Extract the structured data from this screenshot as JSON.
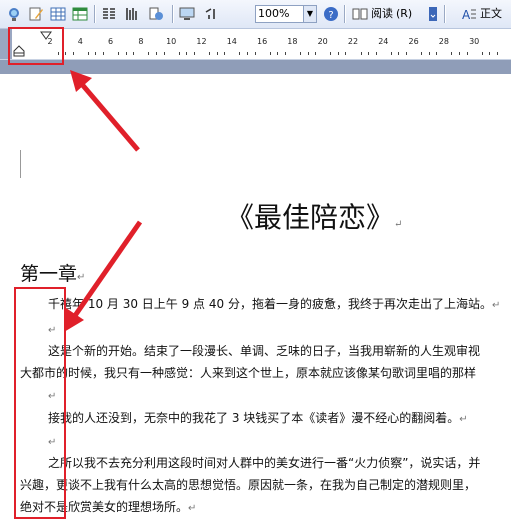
{
  "toolbar": {
    "zoom_value": "100%",
    "read_label": "阅读",
    "read_shortcut": "(R)",
    "style_label": "正文"
  },
  "ruler": {
    "numbers": [
      "2",
      "4",
      "6",
      "8",
      "10",
      "12",
      "14",
      "16",
      "18",
      "20",
      "22",
      "24",
      "26",
      "28",
      "30"
    ]
  },
  "document": {
    "title": "《最佳陪恋》",
    "chapter": "第一章",
    "paragraph_mark": "↵",
    "lines": [
      "千禧年 10 月 30 日上午 9 点 40 分，拖着一身的疲惫，我终于再次走出了上海站。",
      "这是个新的开始。结束了一段漫长、单调、乏味的日子，当我用崭新的人生观审视",
      "大都市的时候，我只有一种感觉：人来到这个世上，原本就应该像某句歌词里唱的那样",
      "接我的人还没到，无奈中的我花了 3 块钱买了本《读者》漫不经心的翻阅着。",
      "之所以我不去充分利用这段时间对人群中的美女进行一番“火力侦察”，说实话，并",
      "兴趣，更谈不上我有什么太高的思想觉悟。原因就一条，在我为自己制定的潜规则里，",
      "绝对不是欣赏美女的理想场所。"
    ]
  },
  "colors": {
    "annotation": "#e0202a",
    "toolbar_bg": "#dfe7f6"
  }
}
